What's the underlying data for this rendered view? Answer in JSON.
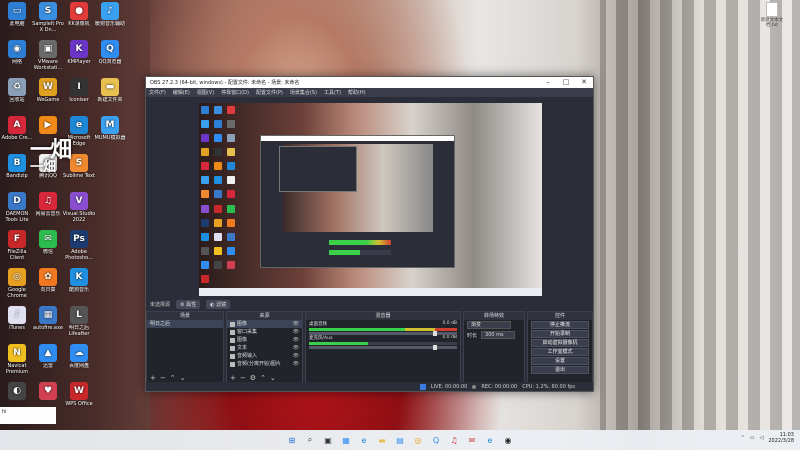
{
  "desktop": {
    "icons": [
      {
        "label": "此电脑",
        "color": "#2d7fd6",
        "glyph": "▭",
        "col": 0,
        "row": 0
      },
      {
        "label": "SampleIt Pro X Dn...",
        "color": "#3a8fe0",
        "glyph": "S",
        "col": 1,
        "row": 0
      },
      {
        "label": "KK录像机",
        "color": "#e23b3b",
        "glyph": "●",
        "col": 2,
        "row": 0
      },
      {
        "label": "暖狗音乐辅助",
        "color": "#3aa0f0",
        "glyph": "♪",
        "col": 3,
        "row": 0
      },
      {
        "label": "网络",
        "color": "#2d7fd6",
        "glyph": "◉",
        "col": 0,
        "row": 1
      },
      {
        "label": "VMware Workstati...",
        "color": "#6a6a6a",
        "glyph": "▣",
        "col": 1,
        "row": 1
      },
      {
        "label": "KMPlayer",
        "color": "#6b35c8",
        "glyph": "K",
        "col": 2,
        "row": 1
      },
      {
        "label": "QQ浏览器",
        "color": "#2f8cf0",
        "glyph": "Q",
        "col": 3,
        "row": 1
      },
      {
        "label": "回收站",
        "color": "#8aa0b8",
        "glyph": "♻",
        "col": 0,
        "row": 2
      },
      {
        "label": "WeGame",
        "color": "#e0a020",
        "glyph": "W",
        "col": 1,
        "row": 2
      },
      {
        "label": "Iconiser",
        "color": "#333",
        "glyph": "I",
        "col": 2,
        "row": 2
      },
      {
        "label": "新建文件夹",
        "color": "#e8c050",
        "glyph": "▬",
        "col": 3,
        "row": 2
      },
      {
        "label": "Adobe Cre...",
        "color": "#d6283a",
        "glyph": "A",
        "col": 0,
        "row": 3
      },
      {
        "label": "",
        "color": "#ef8a18",
        "glyph": "▶",
        "col": 1,
        "row": 3
      },
      {
        "label": "Microsoft Edge",
        "color": "#1e88d6",
        "glyph": "e",
        "col": 2,
        "row": 3
      },
      {
        "label": "MUMU模拟器",
        "color": "#3aa0f0",
        "glyph": "M",
        "col": 3,
        "row": 3
      },
      {
        "label": "Bandizip",
        "color": "#1f8fe0",
        "glyph": "B",
        "col": 0,
        "row": 4
      },
      {
        "label": "腾讯QQ",
        "color": "#f0f0f0",
        "glyph": "Q",
        "col": 1,
        "row": 4
      },
      {
        "label": "Sublime Text",
        "color": "#f08a30",
        "glyph": "S",
        "col": 2,
        "row": 4
      },
      {
        "label": "DAEMON Tools Lite",
        "color": "#3a78c8",
        "glyph": "D",
        "col": 0,
        "row": 5
      },
      {
        "label": "网易云音乐",
        "color": "#d6283a",
        "glyph": "♫",
        "col": 1,
        "row": 5
      },
      {
        "label": "Visual Studio 2022",
        "color": "#8a4fd0",
        "glyph": "V",
        "col": 2,
        "row": 5
      },
      {
        "label": "FileZilla Client",
        "color": "#c8282a",
        "glyph": "F",
        "col": 0,
        "row": 6
      },
      {
        "label": "微信",
        "color": "#2dbd4e",
        "glyph": "✉",
        "col": 1,
        "row": 6
      },
      {
        "label": "Adobe Photosho...",
        "color": "#1c3b70",
        "glyph": "Ps",
        "col": 2,
        "row": 6
      },
      {
        "label": "Google Chrome",
        "color": "#e8a020",
        "glyph": "◎",
        "col": 0,
        "row": 7
      },
      {
        "label": "向日葵",
        "color": "#f07820",
        "glyph": "✿",
        "col": 1,
        "row": 7
      },
      {
        "label": "酷狗音乐",
        "color": "#1f8fe0",
        "glyph": "K",
        "col": 2,
        "row": 7
      },
      {
        "label": "iTunes",
        "color": "#e0e0f0",
        "glyph": "♪",
        "col": 0,
        "row": 8
      },
      {
        "label": "autofire.exe",
        "color": "#3a78c8",
        "glyph": "▦",
        "col": 1,
        "row": 8
      },
      {
        "label": "明日之后 Lifeafter",
        "color": "#555",
        "glyph": "L",
        "col": 2,
        "row": 8
      },
      {
        "label": "Navicat Premium",
        "color": "#f0c020",
        "glyph": "N",
        "col": 0,
        "row": 9
      },
      {
        "label": "迅雷",
        "color": "#2f8cf0",
        "glyph": "▲",
        "col": 1,
        "row": 9
      },
      {
        "label": "百度网盘",
        "color": "#2f8cf0",
        "glyph": "☁",
        "col": 2,
        "row": 9
      },
      {
        "label": "",
        "color": "#444",
        "glyph": "◐",
        "col": 0,
        "row": 10
      },
      {
        "label": "",
        "color": "#d04050",
        "glyph": "♥",
        "col": 1,
        "row": 10
      },
      {
        "label": "WPS Office",
        "color": "#c8282a",
        "glyph": "W",
        "col": 2,
        "row": 10
      }
    ],
    "watermark": "一畑",
    "watermark2": "一畑",
    "top_right_file": "新建文本文档.txt"
  },
  "obs": {
    "title": "OBS 27.2.3 (64-bit, windows) - 配置文件: 未命名 - 场景: 未命名",
    "menu": [
      "文件(F)",
      "编辑(E)",
      "视图(V)",
      "停靠窗口(D)",
      "配置文件(P)",
      "场景集合(S)",
      "工具(T)",
      "帮助(H)"
    ],
    "dock_tabs": {
      "scene_label": "未选择源",
      "props": "属性",
      "filters": "滤镜"
    },
    "scenes": {
      "header": "场景",
      "items": [
        "明日之后"
      ]
    },
    "sources": {
      "header": "来源",
      "items": [
        "图像",
        "窗口采集",
        "图像",
        "文本",
        "音频输入",
        "音频(分离开始)图片"
      ]
    },
    "mixer": {
      "header": "混音器",
      "channels": [
        {
          "name": "桌面音频",
          "db": "0.0 dB"
        },
        {
          "name": "麦克风/Aux",
          "db": "0.0 dB"
        }
      ]
    },
    "transitions": {
      "header": "转场特效",
      "type": "渐变",
      "duration_label": "时长",
      "duration": "300 ms"
    },
    "controls": {
      "header": "控件",
      "buttons": [
        "停止推流",
        "开始录制",
        "启动虚拟摄像机",
        "工作室模式",
        "设置",
        "退出"
      ]
    },
    "status": {
      "live": "LIVE: 00:00:00",
      "rec": "REC: 00:00:00",
      "cpu": "CPU: 1.2%, 60.00 fps"
    }
  },
  "ticker": {
    "text": "hi"
  },
  "taskbar": {
    "icons": [
      {
        "name": "windows-start-icon",
        "glyph": "⊞",
        "color": "#1e6fd9"
      },
      {
        "name": "search-icon",
        "glyph": "⌕",
        "color": "#333"
      },
      {
        "name": "task-view-icon",
        "glyph": "▣",
        "color": "#333"
      },
      {
        "name": "widgets-icon",
        "glyph": "▦",
        "color": "#2f8cf0"
      },
      {
        "name": "edge-icon",
        "glyph": "e",
        "color": "#1e88d6"
      },
      {
        "name": "folder-icon",
        "glyph": "▬",
        "color": "#e8c050"
      },
      {
        "name": "store-icon",
        "glyph": "▤",
        "color": "#2f8cf0"
      },
      {
        "name": "chrome-icon",
        "glyph": "◎",
        "color": "#e8a020"
      },
      {
        "name": "qq-icon",
        "glyph": "Q",
        "color": "#2f8cf0"
      },
      {
        "name": "netease-icon",
        "glyph": "♫",
        "color": "#d6283a"
      },
      {
        "name": "mail-icon",
        "glyph": "✉",
        "color": "#d04050"
      },
      {
        "name": "edge2-icon",
        "glyph": "e",
        "color": "#1e88d6"
      },
      {
        "name": "obs-icon",
        "glyph": "◉",
        "color": "#222"
      }
    ],
    "clock_time": "11:03",
    "clock_date": "2022/3/28"
  }
}
